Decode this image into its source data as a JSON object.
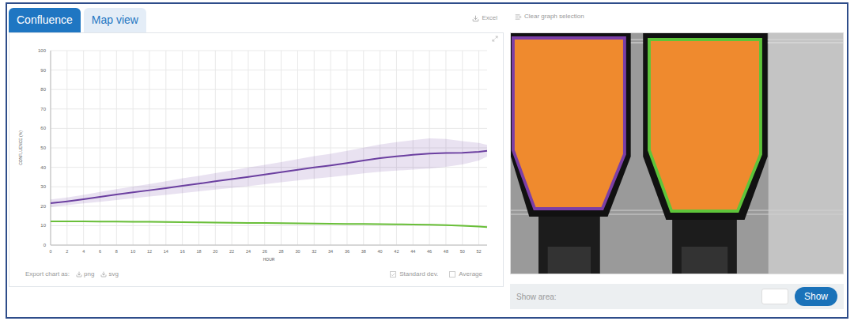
{
  "tabs": [
    {
      "label": "Confluence",
      "selected": true
    },
    {
      "label": "Map view",
      "selected": false
    }
  ],
  "toolbar": {
    "excel": "Excel",
    "clear": "Clear graph selection"
  },
  "chart": {
    "y_axis": {
      "title": "CONFLUENCE (%)",
      "ticks": [
        "0",
        "10",
        "20",
        "30",
        "40",
        "50",
        "60",
        "70",
        "80",
        "90",
        "100"
      ]
    },
    "x_axis": {
      "title": "HOUR",
      "ticks": [
        "0",
        "2",
        "4",
        "6",
        "8",
        "10",
        "12",
        "14",
        "16",
        "18",
        "20",
        "22",
        "24",
        "26",
        "28",
        "30",
        "32",
        "34",
        "36",
        "38",
        "40",
        "42",
        "44",
        "46",
        "48",
        "50",
        "52"
      ]
    },
    "hours": [
      0,
      2,
      4,
      6,
      8,
      10,
      12,
      14,
      16,
      18,
      20,
      22,
      24,
      26,
      28,
      30,
      32,
      34,
      36,
      38,
      40,
      42,
      44,
      46,
      48,
      50,
      52,
      53
    ],
    "series": [
      {
        "color": "#6b3fa0",
        "values": [
          21.5,
          22.5,
          23.6,
          24.8,
          26,
          27.1,
          28.2,
          29.3,
          30.5,
          31.6,
          32.8,
          33.9,
          35.1,
          36.3,
          37.5,
          38.7,
          39.9,
          41,
          42.2,
          43.5,
          44.7,
          45.6,
          46.4,
          47.1,
          47.4,
          47.5,
          48,
          48.5
        ],
        "std": [
          2,
          2,
          2.2,
          2.5,
          2.8,
          3,
          3.2,
          3.5,
          3.8,
          4,
          4.2,
          4.5,
          4.8,
          5,
          5.2,
          5.5,
          5.8,
          6,
          6.3,
          6.6,
          7,
          7.3,
          7.6,
          7.8,
          7.2,
          6,
          4.5,
          3
        ]
      },
      {
        "color": "#6abf3a",
        "values": [
          12.2,
          12.2,
          12.2,
          12.1,
          12.1,
          12,
          12,
          11.9,
          11.8,
          11.7,
          11.6,
          11.5,
          11.4,
          11.4,
          11.3,
          11.2,
          11.1,
          11,
          10.9,
          10.9,
          10.8,
          10.7,
          10.6,
          10.5,
          10.3,
          10,
          9.6,
          9.2
        ],
        "std": [
          0.4,
          0.4,
          0.4,
          0.4,
          0.4,
          0.4,
          0.4,
          0.4,
          0.4,
          0.4,
          0.4,
          0.4,
          0.4,
          0.4,
          0.4,
          0.4,
          0.4,
          0.4,
          0.4,
          0.4,
          0.4,
          0.4,
          0.4,
          0.4,
          0.4,
          0.4,
          0.4,
          0.4
        ]
      }
    ],
    "export": {
      "label": "Export chart as:",
      "formats": [
        "png",
        "svg"
      ]
    },
    "options": [
      {
        "label": "Standard dev.",
        "checked": true
      },
      {
        "label": "Average",
        "checked": false
      }
    ]
  },
  "regions": [
    {
      "color": "#7b3fa6"
    },
    {
      "color": "#5ec43a"
    }
  ],
  "show_area": {
    "label": "Show area:",
    "value": "",
    "button": "Show"
  }
}
